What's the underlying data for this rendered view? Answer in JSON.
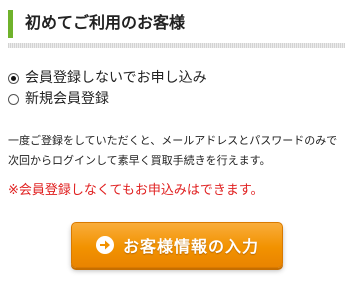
{
  "header": {
    "title": "初めてご利用のお客様"
  },
  "options": [
    {
      "label": "会員登録しないでお申し込み",
      "checked": true
    },
    {
      "label": "新規会員登録",
      "checked": false
    }
  ],
  "description": "一度ご登録をしていただくと、メールアドレスとパスワードのみで次回からログインして素早く買取手続きを行えます。",
  "notice": "※会員登録しなくてもお申込みはできます。",
  "cta": {
    "label": "お客様情報の入力",
    "icon": "arrow-right-circle-icon"
  },
  "colors": {
    "accent_bar": "#6fb22b",
    "notice": "#e02020",
    "button": "#f29200"
  }
}
